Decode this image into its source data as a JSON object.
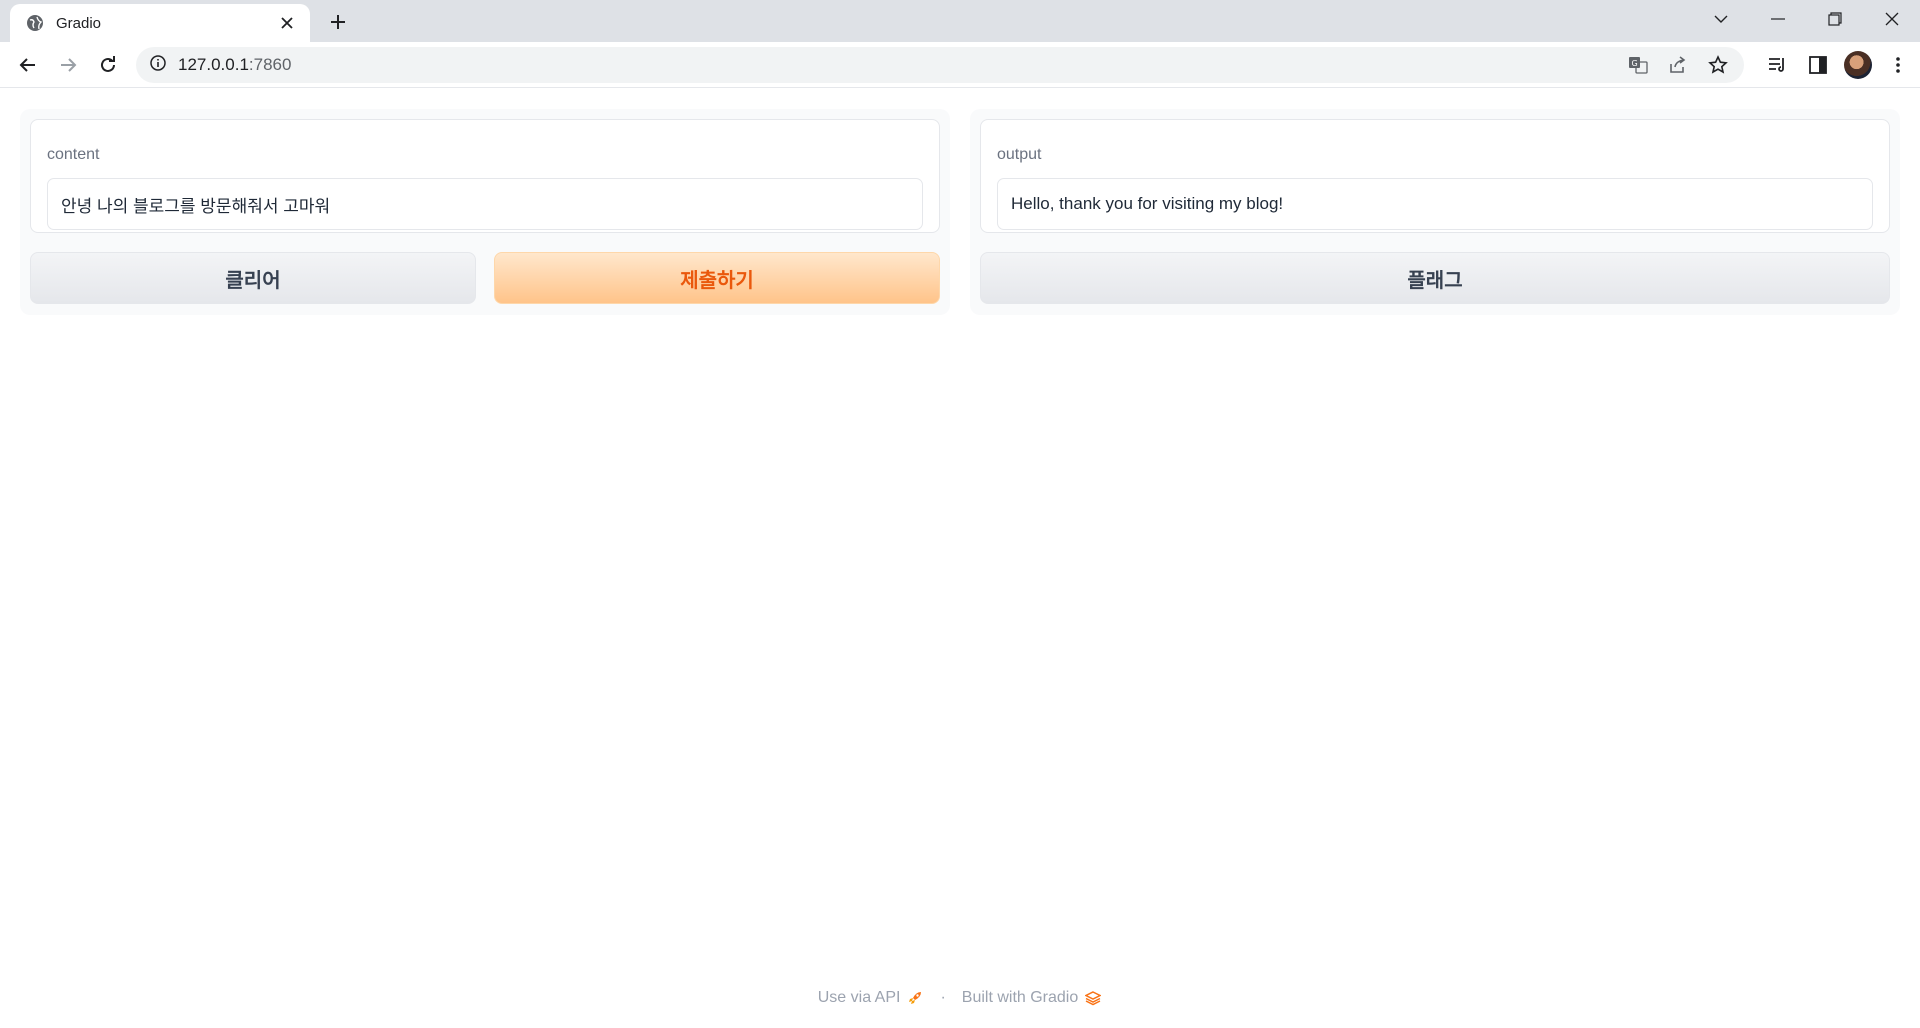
{
  "browser": {
    "tab_title": "Gradio",
    "url_host": "127.0.0.1",
    "url_port": ":7860"
  },
  "input_panel": {
    "label": "content",
    "value": "안녕 나의 블로그를 방문해줘서 고마워",
    "clear_label": "클리어",
    "submit_label": "제출하기"
  },
  "output_panel": {
    "label": "output",
    "value": "Hello, thank you for visiting my blog!",
    "flag_label": "플래그"
  },
  "footer": {
    "api_label": "Use via API",
    "separator": "·",
    "built_label": "Built with Gradio"
  },
  "colors": {
    "accent": "#ea580c",
    "primary_button_bg": "#ffc48a"
  },
  "icons": [
    "globe-icon",
    "close-icon",
    "plus-icon",
    "chevron-down-icon",
    "minimize-icon",
    "restore-icon",
    "window-close-icon",
    "back-icon",
    "forward-icon",
    "reload-icon",
    "info-icon",
    "translate-icon",
    "share-icon",
    "star-icon",
    "reading-list-icon",
    "side-panel-icon",
    "menu-icon",
    "rocket-icon",
    "gradio-logo-icon"
  ]
}
